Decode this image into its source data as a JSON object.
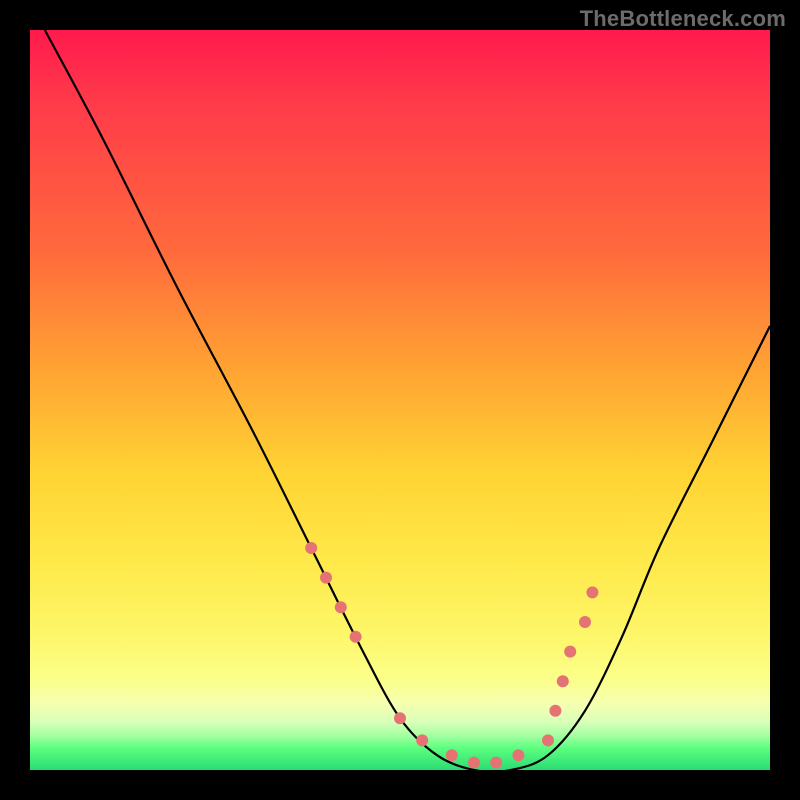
{
  "watermark": "TheBottleneck.com",
  "chart_data": {
    "type": "line",
    "title": "",
    "xlabel": "",
    "ylabel": "",
    "xlim": [
      0,
      100
    ],
    "ylim": [
      0,
      100
    ],
    "grid": false,
    "legend": false,
    "background_gradient": {
      "direction": "vertical",
      "stops": [
        {
          "pos": 0,
          "color": "#ff1a4d",
          "meaning": "high"
        },
        {
          "pos": 50,
          "color": "#ffc040",
          "meaning": "mid"
        },
        {
          "pos": 90,
          "color": "#f8ff90",
          "meaning": "low"
        },
        {
          "pos": 100,
          "color": "#2bdc73",
          "meaning": "optimal"
        }
      ]
    },
    "series": [
      {
        "name": "bottleneck-curve",
        "color": "#000000",
        "x": [
          2,
          10,
          20,
          30,
          38,
          45,
          50,
          55,
          60,
          65,
          70,
          75,
          80,
          85,
          92,
          100
        ],
        "values": [
          100,
          85,
          65,
          46,
          30,
          16,
          7,
          2,
          0,
          0,
          2,
          8,
          18,
          30,
          44,
          60
        ]
      }
    ],
    "markers": {
      "name": "highlight-dots",
      "color": "#e57373",
      "radius": 6,
      "points": [
        {
          "x": 38,
          "y": 30
        },
        {
          "x": 40,
          "y": 26
        },
        {
          "x": 42,
          "y": 22
        },
        {
          "x": 44,
          "y": 18
        },
        {
          "x": 50,
          "y": 7
        },
        {
          "x": 53,
          "y": 4
        },
        {
          "x": 57,
          "y": 2
        },
        {
          "x": 60,
          "y": 1
        },
        {
          "x": 63,
          "y": 1
        },
        {
          "x": 66,
          "y": 2
        },
        {
          "x": 70,
          "y": 4
        },
        {
          "x": 71,
          "y": 8
        },
        {
          "x": 72,
          "y": 12
        },
        {
          "x": 73,
          "y": 16
        },
        {
          "x": 75,
          "y": 20
        },
        {
          "x": 76,
          "y": 24
        }
      ]
    }
  }
}
